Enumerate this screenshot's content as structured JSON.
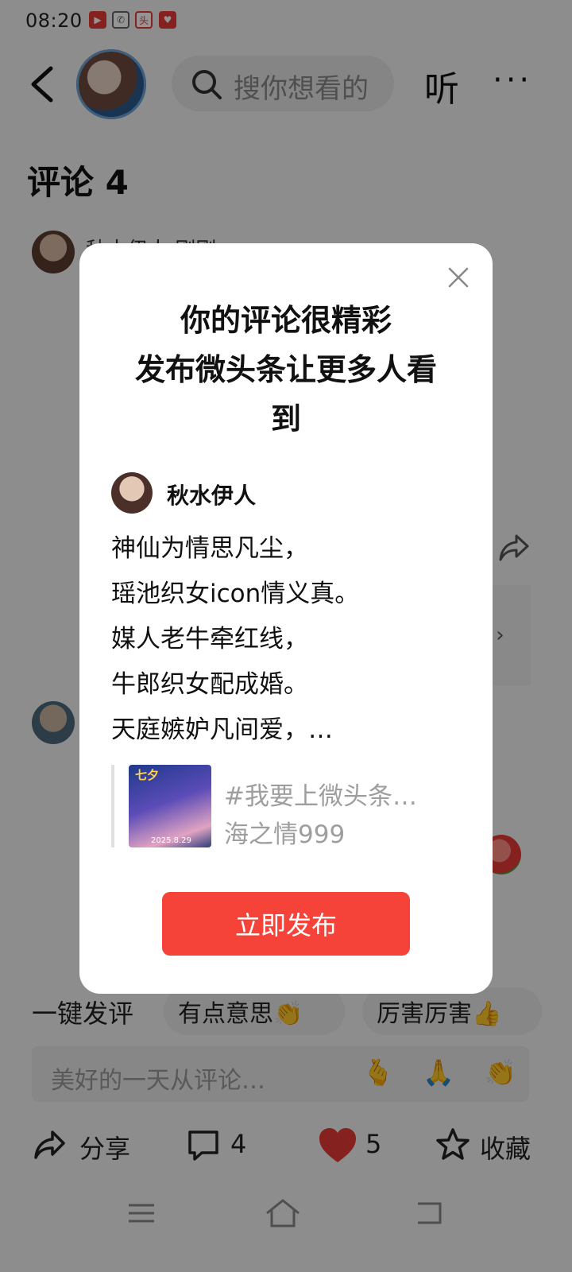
{
  "status_bar": {
    "time": "08:20",
    "icons": [
      "video-app-icon",
      "wechat-icon",
      "toutiao-news-icon",
      "huawei-health-icon"
    ]
  },
  "top_bar": {
    "search_placeholder": "搜你想看的",
    "listen_label": "听",
    "more_label": "···"
  },
  "comments": {
    "title": "评论 4",
    "first_commenter": "秋水伊人 刚刚",
    "side_card_label": "会 ›"
  },
  "quick_reply": {
    "label": "一键发评",
    "chips": [
      "有点意思👏",
      "厉害厉害👍"
    ]
  },
  "comment_input": {
    "placeholder": "美好的一天从评论…",
    "emojis": [
      "🫰",
      "🙏",
      "👏"
    ]
  },
  "actions": {
    "share_label": "分享",
    "comment_count": "4",
    "like_count": "5",
    "favorite_label": "收藏"
  },
  "dialog": {
    "title_lines": [
      "你的评论很精彩",
      "发布微头条让更多人看",
      "到"
    ],
    "author": "秋水伊人",
    "poem_lines": [
      "神仙为情思凡尘，",
      "瑶池织女icon情义真。",
      "媒人老牛牵红线，",
      "牛郎织女配成婚。",
      "天庭嫉妒凡间爱，…"
    ],
    "quote_title": "#我要上微头条…",
    "quote_author": "海之情999",
    "thumb_tag": "七夕",
    "thumb_date": "2025.8.29",
    "publish_label": "立即发布"
  },
  "colors": {
    "accent": "#f5433a",
    "like": "#e53935"
  }
}
